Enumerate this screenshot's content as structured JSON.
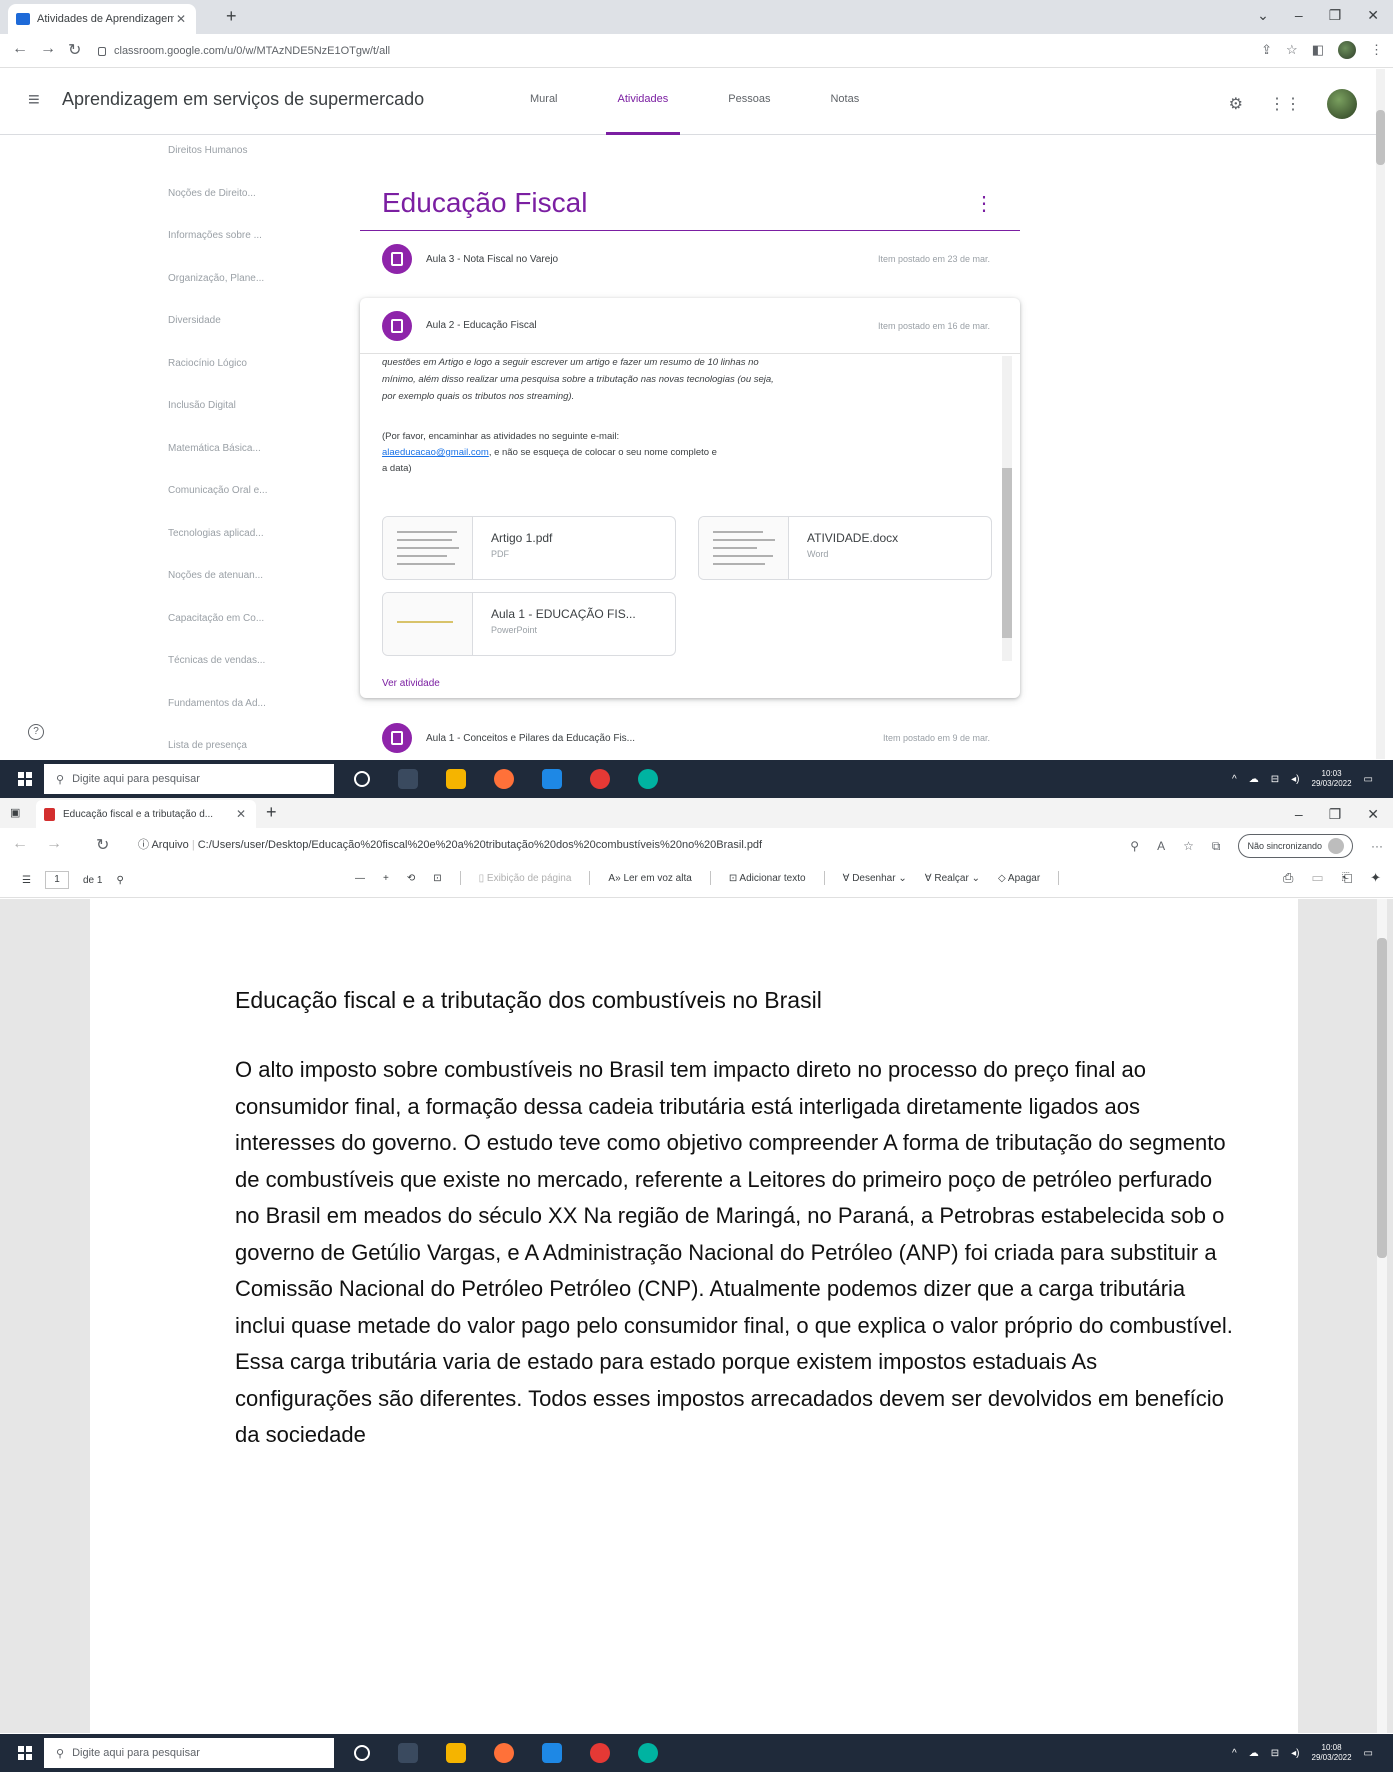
{
  "classroom": {
    "tab_title": "Atividades de Aprendizagem e...",
    "url": "classroom.google.com/u/0/w/MTAzNDE5NzE1OTgw/t/all",
    "course_name": "Aprendizagem em serviços de supermercado",
    "nav_tabs": [
      "Mural",
      "Atividades",
      "Pessoas",
      "Notas"
    ],
    "active_tab": "Atividades",
    "topics": [
      "Direitos Humanos",
      "Noções de Direito...",
      "Informações sobre ...",
      "Organização, Plane...",
      "Diversidade",
      "Raciocínio Lógico",
      "Inclusão Digital",
      "Matemática Básica...",
      "Comunicação Oral e...",
      "Tecnologias aplicad...",
      "Noções de atenuan...",
      "Capacitação em Co...",
      "Técnicas de vendas...",
      "Fundamentos da Ad...",
      "Lista de presença"
    ],
    "section_title": "Educação Fiscal",
    "assignments": [
      {
        "title": "Aula 3 - Nota Fiscal no Varejo",
        "date": "Item postado em 23 de mar."
      },
      {
        "title": "Aula 2 - Educação Fiscal",
        "date": "Item postado em 16 de mar."
      },
      {
        "title": "Aula 1 - Conceitos e Pilares da Educação Fis...",
        "date": "Item postado em 9 de mar."
      }
    ],
    "description": "questões em Artigo e logo a seguir escrever um artigo e fazer um resumo de 10 linhas no mínimo, além disso realizar uma pesquisa sobre a tributação nas novas tecnologias (ou seja, por exemplo quais os tributos nos streaming).",
    "note_prefix": "(Por favor, encaminhar as atividades no seguinte e-mail:",
    "note_email": "alaeducacao@gmail.com",
    "note_suffix": ", e não se esqueça de colocar o seu nome completo e a data)",
    "attachments": [
      {
        "name": "Artigo 1.pdf",
        "type": "PDF"
      },
      {
        "name": "ATIVIDADE.docx",
        "type": "Word"
      },
      {
        "name": "Aula 1 - EDUCAÇÃO FIS...",
        "type": "PowerPoint"
      }
    ],
    "view_link": "Ver atividade",
    "taskbar_search": "Digite aqui para pesquisar",
    "clock_time": "10:03",
    "clock_date": "29/03/2022"
  },
  "pdf_viewer": {
    "tab_title": "Educação fiscal e a tributação d...",
    "address_prefix": "Arquivo",
    "address": "C:/Users/user/Desktop/Educação%20fiscal%20e%20a%20tributação%20dos%20combustíveis%20no%20Brasil.pdf",
    "sync_label": "Não sincronizando",
    "page_number": "1",
    "page_of": "de 1",
    "page_view_label": "Exibição de página",
    "read_aloud_label": "Ler em voz alta",
    "add_text_label": "Adicionar texto",
    "draw_label": "Desenhar",
    "highlight_label": "Realçar",
    "erase_label": "Apagar",
    "document_title": "Educação fiscal e a tributação dos combustíveis no Brasil",
    "document_body": "O alto imposto sobre combustíveis no Brasil tem impacto direto no processo do preço final ao consumidor final, a formação dessa cadeia tributária está interligada diretamente ligados aos interesses do governo. O estudo teve como objetivo compreender A forma de tributação do segmento de combustíveis que existe no mercado, referente a Leitores do primeiro poço de petróleo perfurado no Brasil em meados do século XX Na região de Maringá, no Paraná, a Petrobras estabelecida sob o governo de Getúlio Vargas, e A Administração Nacional do Petróleo (ANP) foi criada para substituir a Comissão Nacional do Petróleo Petróleo (CNP). Atualmente podemos dizer que a carga tributária inclui quase metade do valor pago pelo consumidor final, o que explica o valor próprio do combustível. Essa carga tributária varia de estado para estado porque existem impostos estaduais As configurações são diferentes. Todos esses impostos arrecadados devem ser devolvidos em benefício da sociedade",
    "taskbar_search": "Digite aqui para pesquisar",
    "clock_time": "10:08",
    "clock_date": "29/03/2022"
  },
  "colors": {
    "classroom_accent": "#7b1fa2",
    "taskbar": "#1f2a3a",
    "link": "#1a73e8"
  }
}
